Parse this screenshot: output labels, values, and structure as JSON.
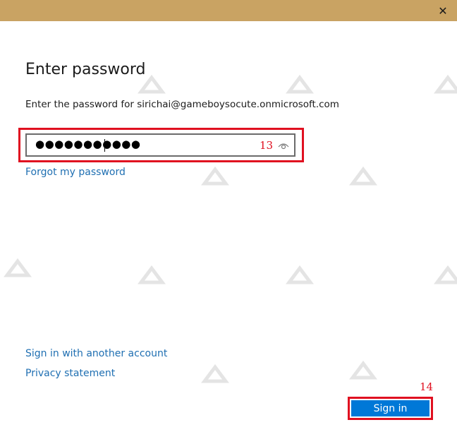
{
  "dialog": {
    "close_glyph": "✕",
    "heading": "Enter password",
    "instruction": "Enter the password for sirichai@gameboysocute.onmicrosoft.com",
    "password": {
      "masked_value": "●●●●●●●●●●●",
      "reveal_icon": "eye-icon"
    },
    "forgot_link": "Forgot my password",
    "other_account_link": "Sign in with another account",
    "privacy_link": "Privacy statement",
    "signin_button": "Sign in"
  },
  "annotations": {
    "step_password": "13",
    "step_signin": "14"
  },
  "colors": {
    "titlebar": "#c9a363",
    "accent": "#0078d7",
    "link": "#1f6fb2",
    "highlight": "#e01020"
  }
}
